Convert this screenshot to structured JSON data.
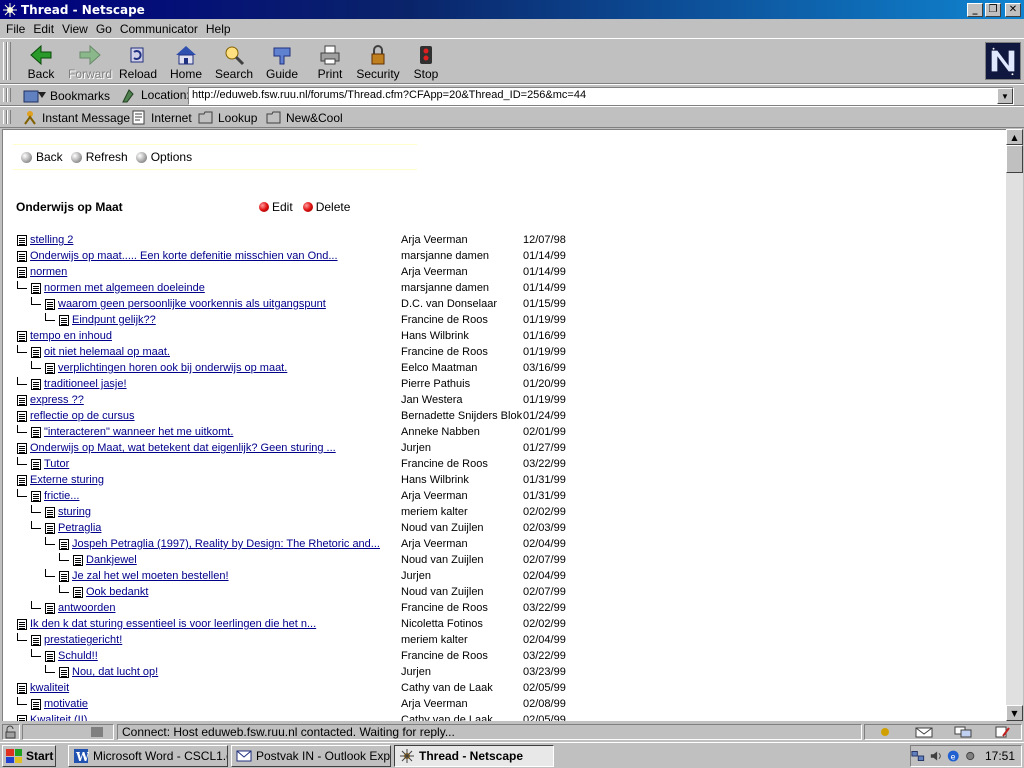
{
  "window": {
    "title": "Thread - Netscape"
  },
  "menu": [
    "File",
    "Edit",
    "View",
    "Go",
    "Communicator",
    "Help"
  ],
  "nav_buttons": [
    {
      "label": "Back",
      "icon": "back-arrow-icon",
      "enabled": true
    },
    {
      "label": "Forward",
      "icon": "forward-arrow-icon",
      "enabled": false
    },
    {
      "label": "Reload",
      "icon": "reload-icon",
      "enabled": true
    },
    {
      "label": "Home",
      "icon": "home-icon",
      "enabled": true
    },
    {
      "label": "Search",
      "icon": "search-icon",
      "enabled": true
    },
    {
      "label": "Guide",
      "icon": "guide-icon",
      "enabled": true
    },
    {
      "label": "Print",
      "icon": "printer-icon",
      "enabled": true
    },
    {
      "label": "Security",
      "icon": "padlock-icon",
      "enabled": true
    },
    {
      "label": "Stop",
      "icon": "stop-icon",
      "enabled": true
    }
  ],
  "location": {
    "bookmarks_label": "Bookmarks",
    "label": "Location:",
    "url": "http://eduweb.fsw.ruu.nl/forums/Thread.cfm?CFApp=20&Thread_ID=256&mc=44"
  },
  "personal_toolbar": [
    "Instant Message",
    "Internet",
    "Lookup",
    "New&Cool"
  ],
  "forum_nav": [
    "Back",
    "Refresh",
    "Options"
  ],
  "thread": {
    "title": "Onderwijs op Maat",
    "actions": [
      "Edit",
      "Delete"
    ],
    "posts": [
      {
        "level": 0,
        "title": "stelling 2",
        "author": "Arja Veerman",
        "date": "12/07/98"
      },
      {
        "level": 0,
        "title": "Onderwijs op maat..... Een korte defenitie misschien van Ond...",
        "author": "marsjanne damen",
        "date": "01/14/99"
      },
      {
        "level": 0,
        "title": "normen",
        "author": "Arja Veerman",
        "date": "01/14/99"
      },
      {
        "level": 1,
        "title": "normen met algemeen doeleinde",
        "author": "marsjanne damen",
        "date": "01/14/99"
      },
      {
        "level": 2,
        "title": "waarom geen persoonlijke voorkennis als uitgangspunt",
        "author": "D.C. van Donselaar",
        "date": "01/15/99"
      },
      {
        "level": 3,
        "title": "Eindpunt gelijk??",
        "author": "Francine de Roos",
        "date": "01/19/99"
      },
      {
        "level": 0,
        "title": "tempo en inhoud",
        "author": "Hans Wilbrink",
        "date": "01/16/99"
      },
      {
        "level": 1,
        "title": "oit niet helemaal op maat.",
        "author": "Francine de Roos",
        "date": "01/19/99"
      },
      {
        "level": 2,
        "title": "verplichtingen horen ook bij onderwijs op maat.",
        "author": "Eelco Maatman",
        "date": "03/16/99"
      },
      {
        "level": 1,
        "title": "traditioneel jasje!",
        "author": "Pierre Pathuis",
        "date": "01/20/99"
      },
      {
        "level": 0,
        "title": "express ??",
        "author": "Jan Westera",
        "date": "01/19/99"
      },
      {
        "level": 0,
        "title": "reflectie op de cursus",
        "author": "Bernadette Snijders Blok",
        "date": "01/24/99"
      },
      {
        "level": 1,
        "title": "\"interacteren\" wanneer het me uitkomt.",
        "author": "Anneke Nabben",
        "date": "02/01/99"
      },
      {
        "level": 0,
        "title": "Onderwijs op Maat, wat betekent dat eigenlijk? Geen sturing ...",
        "author": "Jurjen",
        "date": "01/27/99"
      },
      {
        "level": 1,
        "title": "Tutor",
        "author": "Francine de Roos",
        "date": "03/22/99"
      },
      {
        "level": 0,
        "title": "Externe sturing",
        "author": "Hans Wilbrink",
        "date": "01/31/99"
      },
      {
        "level": 1,
        "title": "frictie...",
        "author": "Arja Veerman",
        "date": "01/31/99"
      },
      {
        "level": 2,
        "title": "sturing",
        "author": "meriem kalter",
        "date": "02/02/99"
      },
      {
        "level": 2,
        "title": "Petraglia",
        "author": "Noud van Zuijlen",
        "date": "02/03/99"
      },
      {
        "level": 3,
        "title": "Jospeh Petraglia (1997), Reality by Design: The Rhetoric and...",
        "author": "Arja Veerman",
        "date": "02/04/99"
      },
      {
        "level": 4,
        "title": "Dankjewel",
        "author": "Noud van Zuijlen",
        "date": "02/07/99"
      },
      {
        "level": 3,
        "title": "Je zal het wel moeten bestellen!",
        "author": "Jurjen",
        "date": "02/04/99"
      },
      {
        "level": 4,
        "title": "Ook bedankt",
        "author": "Noud van Zuijlen",
        "date": "02/07/99"
      },
      {
        "level": 2,
        "title": "antwoorden",
        "author": "Francine de Roos",
        "date": "03/22/99"
      },
      {
        "level": 0,
        "title": "Ik den k dat sturing essentieel is voor leerlingen die het n...",
        "author": "Nicoletta Fotinos",
        "date": "02/02/99"
      },
      {
        "level": 1,
        "title": "prestatiegericht!",
        "author": "meriem kalter",
        "date": "02/04/99"
      },
      {
        "level": 2,
        "title": "Schuld!!",
        "author": "Francine de Roos",
        "date": "03/22/99"
      },
      {
        "level": 3,
        "title": "Nou, dat lucht op!",
        "author": "Jurjen",
        "date": "03/23/99"
      },
      {
        "level": 0,
        "title": "kwaliteit",
        "author": "Cathy van de Laak",
        "date": "02/05/99"
      },
      {
        "level": 1,
        "title": "motivatie",
        "author": "Arja Veerman",
        "date": "02/08/99"
      },
      {
        "level": 0,
        "title": "Kwaliteit (II)",
        "author": "Cathy van de Laak",
        "date": "02/05/99"
      }
    ]
  },
  "status": {
    "text": "Connect: Host eduweb.fsw.ruu.nl contacted. Waiting for reply..."
  },
  "taskbar": {
    "start_label": "Start",
    "tasks": [
      {
        "label": "Microsoft Word - CSCL1.doc",
        "icon": "word-icon",
        "active": false
      },
      {
        "label": "Postvak IN - Outlook Expr...",
        "icon": "outlook-icon",
        "active": false
      },
      {
        "label": "Thread - Netscape",
        "icon": "netscape-icon",
        "active": true
      }
    ],
    "clock": "17:51"
  },
  "colors": {
    "title_bar": "#000080",
    "link": "#00008b",
    "accent_red": "#e01010"
  }
}
